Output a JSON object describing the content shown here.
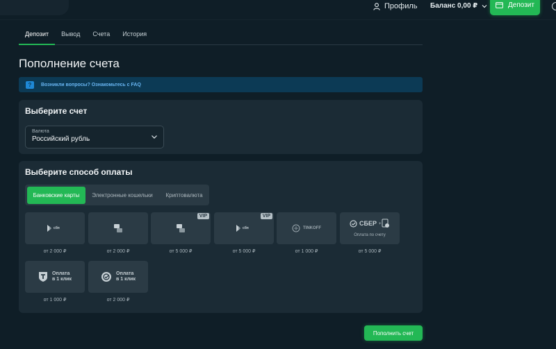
{
  "header": {
    "profile_label": "Профиль",
    "balance_label": "Баланс 0,00 ₽",
    "deposit_label": "Депозит"
  },
  "tabs": [
    {
      "label": "Депозит",
      "active": true
    },
    {
      "label": "Вывод",
      "active": false
    },
    {
      "label": "Счета",
      "active": false
    },
    {
      "label": "История",
      "active": false
    }
  ],
  "page_title": "Пополнение счета",
  "faq_banner": {
    "icon": "question-bubble-icon",
    "text": "Возникли вопросы? Ознакомьтесь с FAQ"
  },
  "account_card": {
    "title": "Выберите счет",
    "currency_label": "Валюта",
    "currency_value": "Российский рубль"
  },
  "payment_card": {
    "title": "Выберите способ оплаты",
    "segments": [
      {
        "label": "Банковские карты",
        "active": true
      },
      {
        "label": "Электронные кошельки",
        "active": false
      },
      {
        "label": "Криптовалюта",
        "active": false
      }
    ],
    "methods": [
      {
        "name": "sbp",
        "logo": "sbp-logo-icon",
        "vip": "",
        "price": "от 2 000 ₽"
      },
      {
        "name": "card-transfer",
        "logo": "card-transfer-icon",
        "vip": "",
        "price": "от 2 000 ₽"
      },
      {
        "name": "card-transfer-vip",
        "logo": "card-transfer-icon",
        "vip": "VIP",
        "price": "от 5 000 ₽"
      },
      {
        "name": "sbp-vip",
        "logo": "sbp-logo-icon",
        "vip": "VIP",
        "price": "от 5 000 ₽"
      },
      {
        "name": "tinkoff",
        "logo": "tinkoff-logo-icon",
        "vip": "",
        "logo_text": "TINKOFF",
        "price": "от 1 000 ₽"
      },
      {
        "name": "sber",
        "logo": "sber-logo-icon",
        "vip": "",
        "logo_text": "СБЕР",
        "subtext": "Оплата по счету",
        "price": "от 5 000 ₽"
      },
      {
        "name": "t-pay",
        "logo": "t-bank-logo-icon",
        "vip": "",
        "logo_text": "Оплата\nв 1 клик",
        "price": "от 1 000 ₽"
      },
      {
        "name": "sber-pay",
        "logo": "sberpay-logo-icon",
        "vip": "",
        "logo_text": "Оплата\nв 1 клик",
        "price": "от 2 000 ₽"
      }
    ]
  },
  "submit_label": "Пополнить счет",
  "colors": {
    "background": "#0f1e27",
    "card": "#1b2b35",
    "accent_green": "#23b855",
    "faq_blue": "#68b5f2"
  }
}
